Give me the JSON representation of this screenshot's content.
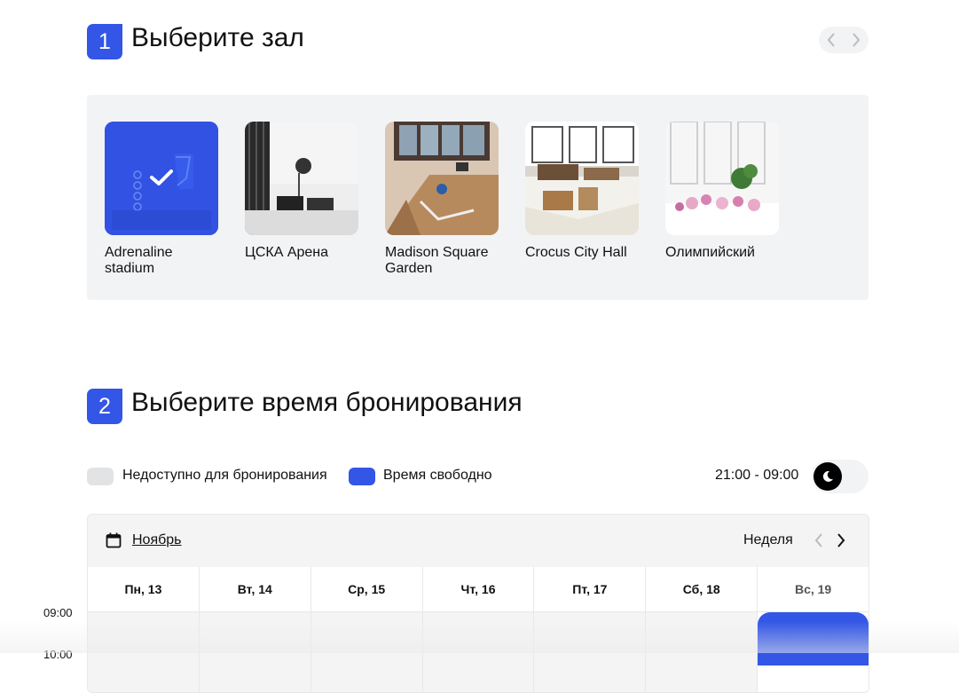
{
  "colors": {
    "accent": "#3356e6",
    "panel_bg": "#f2f3f5",
    "unavailable": "#e2e3e5"
  },
  "step1": {
    "number": "1",
    "title": "Выберите зал",
    "halls": [
      {
        "name": "Adrenaline\nstadium",
        "selected": true
      },
      {
        "name": "ЦСКА Арена",
        "selected": false
      },
      {
        "name": "Madison Square\nGarden",
        "selected": false
      },
      {
        "name": "Crocus City Hall",
        "selected": false
      },
      {
        "name": "Олимпийский",
        "selected": false
      }
    ]
  },
  "step2": {
    "number": "2",
    "title": "Выберите время бронирования",
    "legend": {
      "unavailable": "Недоступно для бронирования",
      "free": "Время свободно"
    },
    "night_range": "21:00 - 09:00",
    "calendar": {
      "month": "Ноябрь",
      "view": "Неделя",
      "days": [
        "Пн, 13",
        "Вт, 14",
        "Ср, 15",
        "Чт, 16",
        "Пт, 17",
        "Сб, 18",
        "Вс, 19"
      ],
      "times": [
        "09:00",
        "10:00"
      ]
    }
  }
}
